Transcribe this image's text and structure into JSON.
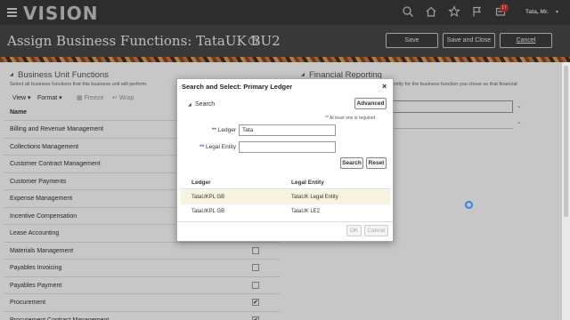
{
  "app": {
    "logo": "VISION",
    "user": "Tata, Mr.",
    "notification_count": "17",
    "icons": [
      "search-icon",
      "home-icon",
      "star-icon",
      "flag-icon",
      "bell-icon"
    ]
  },
  "header": {
    "title": "Assign Business Functions: TataUK BU2",
    "help_glyph": "?",
    "save_label": "Save",
    "save_close_label": "Save and Close",
    "cancel_label": "Cancel"
  },
  "left_panel": {
    "title": "Business Unit Functions",
    "description": "Select all business functions that this business unit will perform.",
    "toolbar": {
      "view": "View",
      "format": "Format",
      "freeze": "Freeze",
      "wrap": "Wrap"
    },
    "column_header": "Name",
    "rows": [
      {
        "name": "Billing and Revenue Management",
        "checked": null
      },
      {
        "name": "Collections Management",
        "checked": null
      },
      {
        "name": "Customer Contract Management",
        "checked": null
      },
      {
        "name": "Customer Payments",
        "checked": null
      },
      {
        "name": "Expense Management",
        "checked": null
      },
      {
        "name": "Incentive Compensation",
        "checked": null
      },
      {
        "name": "Lease Accounting",
        "checked": null
      },
      {
        "name": "Materials Management",
        "checked": false
      },
      {
        "name": "Payables Invoicing",
        "checked": false
      },
      {
        "name": "Payables Payment",
        "checked": false
      },
      {
        "name": "Procurement",
        "checked": true
      },
      {
        "name": "Procurement Contract Management",
        "checked": true
      }
    ]
  },
  "right_panel": {
    "title": "Financial Reporting",
    "description": "entity for the business function you chose so that financial"
  },
  "dialog": {
    "title": "Search and Select: Primary Ledger",
    "close_glyph": "×",
    "search_label": "Search",
    "advanced_label": "Advanced",
    "required_hint": "** At least one is required",
    "required_marker": "**",
    "ledger_label": "Ledger",
    "ledger_value": "Tata",
    "legal_entity_label": "Legal Entity",
    "legal_entity_value": "",
    "search_button": "Search",
    "reset_button": "Reset",
    "columns": [
      "Ledger",
      "Legal Entity"
    ],
    "results": [
      {
        "ledger": "TataUKPL GB",
        "legal_entity": "TataUK Legal Entity",
        "selected": true
      },
      {
        "ledger": "TataUKPL GB",
        "legal_entity": "TataUK LE2",
        "selected": false
      }
    ],
    "ok_label": "OK",
    "cancel_label": "Cancel"
  },
  "colors": {
    "topbar": "#3a3a3a",
    "header": "#4a4a4a",
    "required_marker": "#3b6fb6",
    "selected_row": "#f7f3df",
    "badge": "#c0392b"
  }
}
